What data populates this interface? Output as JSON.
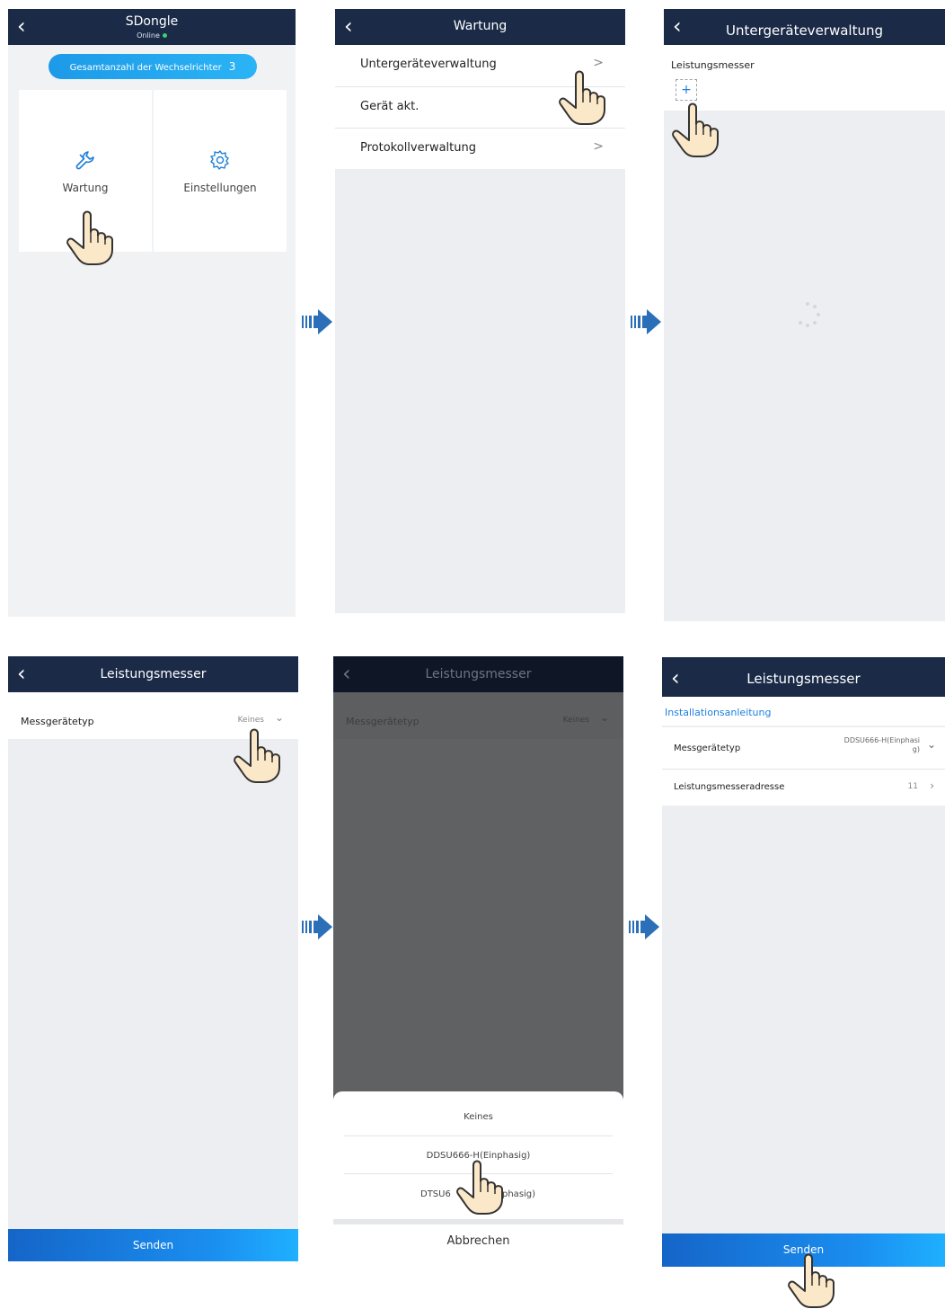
{
  "screen1": {
    "title": "SDongle",
    "status": "Online",
    "inverter_count_label": "Gesamtanzahl der Wechselrichter",
    "inverter_count": "3",
    "tiles": [
      {
        "label": "Wartung",
        "icon": "wrench-icon"
      },
      {
        "label": "Einstellungen",
        "icon": "gear-icon"
      }
    ]
  },
  "screen2": {
    "title": "Wartung",
    "items": [
      {
        "label": "Untergeräteverwaltung",
        "chevron": ">"
      },
      {
        "label": "Gerät akt.",
        "chevron": ""
      },
      {
        "label": "Protokollverwaltung",
        "chevron": ">"
      }
    ]
  },
  "screen3": {
    "title": "Untergeräteverwaltung",
    "section_label": "Leistungsmesser",
    "add_symbol": "+"
  },
  "screen4": {
    "title": "Leistungsmesser",
    "field_label": "Messgerätetyp",
    "field_value": "Keines",
    "send_label": "Senden"
  },
  "screen5": {
    "title": "Leistungsmesser",
    "field_label": "Messgerätetyp",
    "field_value": "Keines",
    "options": [
      "Keines",
      "DDSU666-H(Einphasig)",
      "DTSU666-H(Dreiphasig)"
    ],
    "options_visible": [
      "Keines",
      "DDSU666-H(Einphasig)",
      "DTSU6",
      "phasig)"
    ],
    "cancel_label": "Abbrechen"
  },
  "screen6": {
    "title": "Leistungsmesser",
    "guide_link": "Installationsanleitung",
    "field_label": "Messgerätetyp",
    "field_value_line1": "DDSU666-H(Einphasi",
    "field_value_line2": "g)",
    "address_label": "Leistungsmesseradresse",
    "address_value": "11",
    "send_label": "Senden"
  },
  "colors": {
    "header": "#1a2a47",
    "accent": "#1a8ef0",
    "link": "#1f7fe0",
    "background": "#eceef1"
  }
}
